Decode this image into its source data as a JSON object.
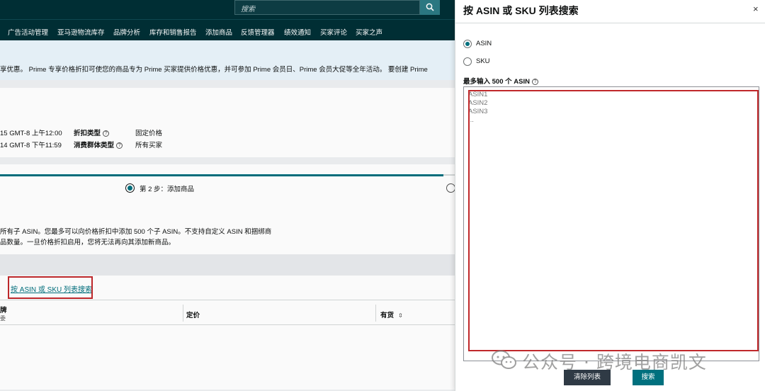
{
  "page": {
    "search_placeholder": "搜索",
    "nav_items": [
      "广告活动管理",
      "亚马逊物流库存",
      "品牌分析",
      "库存和销售报告",
      "添加商品",
      "反馈管理器",
      "绩效通知",
      "买家评论",
      "买家之声"
    ],
    "banner_text": "享优惠。 Prime 专享价格折扣可使您的商品专为 Prime 买家提供价格优惠，并可参加 Prime 会员日、Prime 会员大促等全年活动。 要创建 Prime",
    "details": {
      "start_time": "15 GMT-8 上午12:00",
      "end_time": "14 GMT-8 下午11:59",
      "discount_type_label": "折扣类型",
      "discount_type_value": "固定价格",
      "consumer_group_label": "消费群体类型",
      "consumer_group_value": "所有买家"
    },
    "step2_label": "第 2 步：添加商品",
    "description_line1": "所有子 ASIN。您最多可以向价格折扣中添加 500 个子 ASIN。不支持自定义 ASIN 和捆绑商",
    "description_line2": "品数量。一旦价格折扣启用，您将无法再向其添加新商品。",
    "list_search_link": "按 ASIN 或 SKU 列表搜索",
    "table": {
      "col1_line1": "牌",
      "col1_line2": "委",
      "col2": "定价",
      "col3": "有货"
    }
  },
  "panel": {
    "title": "按 ASIN 或 SKU 列表搜索",
    "close": "×",
    "options": [
      {
        "label": "ASIN",
        "checked": true
      },
      {
        "label": "SKU",
        "checked": false
      }
    ],
    "max_label": "最多输入 500 个 ASIN",
    "textarea_placeholder": "ASIN1\nASIN2\nASIN3\n...",
    "clear_button": "清除列表",
    "search_button": "搜索"
  },
  "watermark": "公众号 · 跨境电商凯文",
  "colors": {
    "nav_bg": "#002f36",
    "accent": "#00707e",
    "highlight_red": "#c0282b",
    "banner_bg": "#e9f4fb"
  }
}
